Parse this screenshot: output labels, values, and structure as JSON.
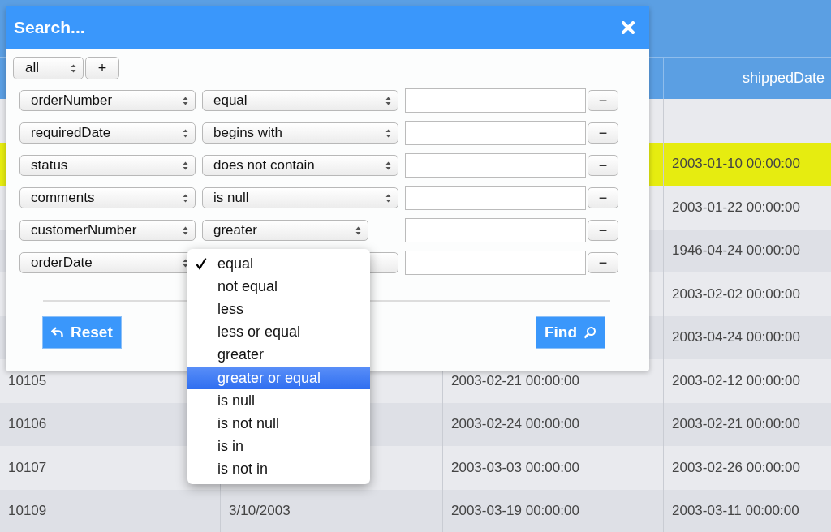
{
  "table": {
    "column_4_header": "shippedDate",
    "rows": [
      {
        "selected": false
      },
      {
        "selected": true,
        "column_4": "2003-01-10 00:00:00"
      },
      {
        "selected": false,
        "column_4": "2003-01-22 00:00:00"
      },
      {
        "selected": false,
        "column_4": "1946-04-24 00:00:00"
      },
      {
        "selected": false,
        "column_4": "2003-02-02 00:00:00"
      },
      {
        "selected": false,
        "column_4": "2003-04-24 00:00:00"
      },
      {
        "selected": false,
        "column_1": "10105",
        "column_3": "2003-02-21 00:00:00",
        "column_4": "2003-02-12 00:00:00"
      },
      {
        "selected": false,
        "column_1": "10106",
        "column_3": "2003-02-24 00:00:00",
        "column_4": "2003-02-21 00:00:00"
      },
      {
        "selected": false,
        "column_1": "10107",
        "column_3": "2003-03-03 00:00:00",
        "column_4": "2003-02-26 00:00:00"
      },
      {
        "selected": false,
        "column_1": "10109",
        "column_2": "3/10/2003",
        "column_3": "2003-03-19 00:00:00",
        "column_4": "2003-03-11 00:00:00"
      }
    ]
  },
  "dialog": {
    "title": "Search...",
    "match": "all",
    "add_button": "+",
    "conditions": [
      {
        "field": "orderNumber",
        "operator": "equal",
        "remove": "−"
      },
      {
        "field": "requiredDate",
        "operator": "begins with",
        "remove": "−"
      },
      {
        "field": "status",
        "operator": "does not contain",
        "remove": "−"
      },
      {
        "field": "comments",
        "operator": "is null",
        "remove": "−"
      },
      {
        "field": "customerNumber",
        "operator": "greater",
        "remove": "−"
      },
      {
        "field": "orderDate",
        "remove": "−"
      }
    ],
    "reset_button": "Reset",
    "find_button": "Find"
  },
  "dropdown": {
    "options": [
      {
        "label": "equal",
        "checked": true,
        "selected": false
      },
      {
        "label": "not equal",
        "checked": false,
        "selected": false
      },
      {
        "label": "less",
        "checked": false,
        "selected": false
      },
      {
        "label": "less or equal",
        "checked": false,
        "selected": false
      },
      {
        "label": "greater",
        "checked": false,
        "selected": false
      },
      {
        "label": "greater or equal",
        "checked": false,
        "selected": true
      },
      {
        "label": "is null",
        "checked": false,
        "selected": false
      },
      {
        "label": "is not null",
        "checked": false,
        "selected": false
      },
      {
        "label": "is in",
        "checked": false,
        "selected": false
      },
      {
        "label": "is not in",
        "checked": false,
        "selected": false
      }
    ]
  }
}
